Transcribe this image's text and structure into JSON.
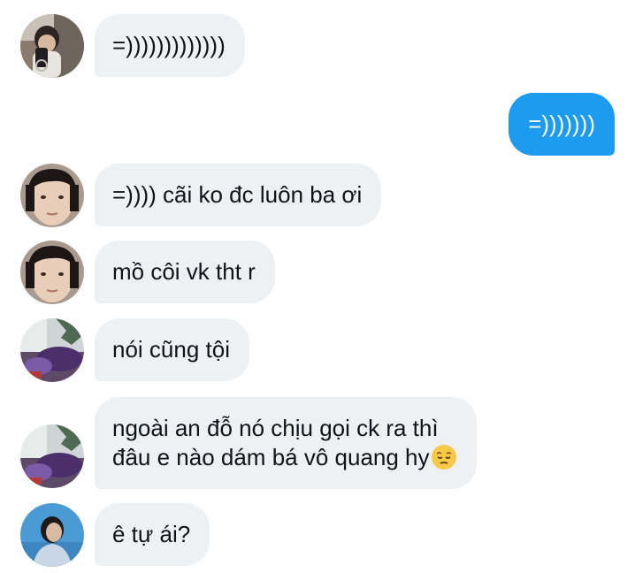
{
  "messages": [
    {
      "sender": "them",
      "avatar": "avatar-boy-mirror-selfie",
      "text": "=)))))))))))))"
    },
    {
      "sender": "me",
      "text": "=)))))))"
    },
    {
      "sender": "them",
      "avatar": "avatar-boy-closeup",
      "text": "=)))) cãi ko đc luôn ba ơi"
    },
    {
      "sender": "them",
      "avatar": "avatar-boy-closeup",
      "text": "mồ côi vk tht r"
    },
    {
      "sender": "them",
      "avatar": "avatar-purple-room",
      "text": "nói cũng tội"
    },
    {
      "sender": "them",
      "avatar": "avatar-purple-room",
      "line1": "ngoài an đỗ nó chịu gọi ck ra thì",
      "line2": "đâu e nào dám bá vô quang hy",
      "emoji": "pensive-face-emoji"
    },
    {
      "sender": "them",
      "avatar": "avatar-boy-blue-sky",
      "text": "ê tự ái?"
    }
  ],
  "colors": {
    "incoming_bubble": "#eef1f3",
    "outgoing_bubble": "#1d9bf0",
    "incoming_text": "#0f1419",
    "outgoing_text": "#ffffff"
  }
}
